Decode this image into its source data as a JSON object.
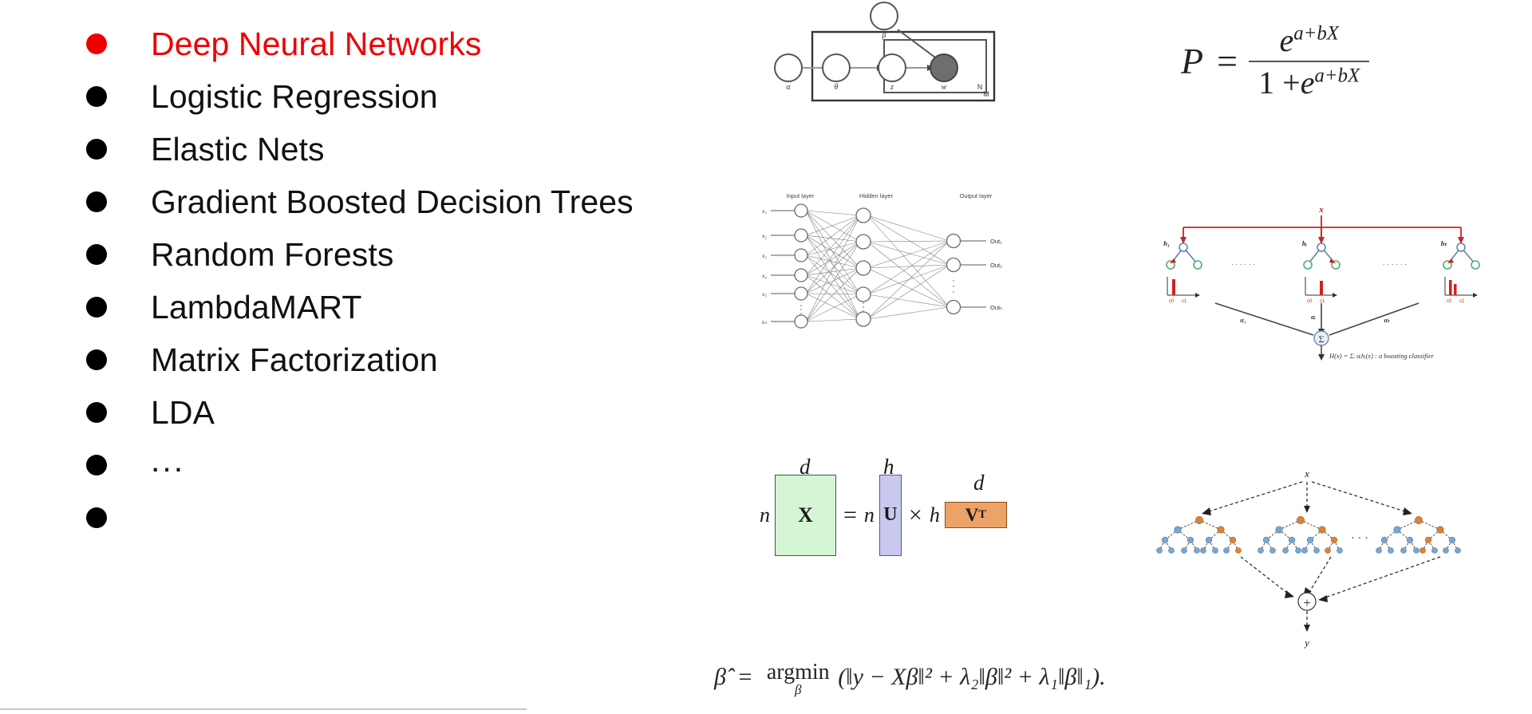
{
  "slide": {
    "background_color": "#ffffff",
    "highlight_color": "#ee0000",
    "text_color": "#111111"
  },
  "bullet_list": {
    "items": [
      {
        "label": "Deep Neural Networks",
        "highlighted": true
      },
      {
        "label": "Logistic Regression",
        "highlighted": false
      },
      {
        "label": "Elastic Nets",
        "highlighted": false
      },
      {
        "label": "Gradient Boosted Decision Trees",
        "highlighted": false
      },
      {
        "label": "Random Forests",
        "highlighted": false
      },
      {
        "label": "LambdaMART",
        "highlighted": false
      },
      {
        "label": "Matrix Factorization",
        "highlighted": false
      },
      {
        "label": "LDA",
        "highlighted": false
      },
      {
        "label": "...",
        "highlighted": false
      },
      {
        "label": "",
        "highlighted": false
      }
    ]
  },
  "figures": {
    "lda_plate": {
      "name": "LDA plate diagram",
      "nodes": [
        {
          "id": "alpha",
          "label": "α",
          "shaded": false
        },
        {
          "id": "theta",
          "label": "θ",
          "shaded": false
        },
        {
          "id": "z",
          "label": "z",
          "shaded": false
        },
        {
          "id": "w",
          "label": "w",
          "shaded": true
        },
        {
          "id": "beta",
          "label": "β",
          "shaded": false
        }
      ],
      "plates": [
        {
          "id": "outer",
          "label": "M"
        },
        {
          "id": "inner",
          "label": "N"
        }
      ]
    },
    "logistic_formula": {
      "lhs": "P",
      "equals": "=",
      "numerator_base": "e",
      "numerator_exponent": "a+bX",
      "denominator_one": "1 +",
      "denominator_base": "e",
      "denominator_exponent": "a+bX"
    },
    "neural_network": {
      "layer_labels": [
        "Input layer",
        "Hidden layer",
        "Output layer"
      ],
      "input_labels": [
        "x₁",
        "x₂",
        "x₃",
        "x₄",
        "x₅",
        "xₙ"
      ],
      "output_labels": [
        "Out₁",
        "Out₂",
        "Outₙ"
      ],
      "input_count": 6,
      "hidden_count": 5,
      "output_count": 3
    },
    "boosting": {
      "input_label": "x",
      "classifier_labels": [
        "h₁",
        "hᵢ",
        "hₜ"
      ],
      "weight_labels": [
        "α₁",
        "αᵢ",
        "αₜ"
      ],
      "leaf_axis_labels": [
        "c0",
        "c1"
      ],
      "sum_symbol": "Σ",
      "caption": "H(x) = Σᵢ αᵢhᵢ(x) : a boosting classifier",
      "ellipsis": "· · · · · ·",
      "arrow_color": "#cc2222",
      "node_color": "#7b97c4",
      "leaf_color": "#4fae72"
    },
    "matrix_factorization": {
      "left_dim_top": "d",
      "left_dim_side": "n",
      "left_matrix": "X",
      "left_color": "#d5f5d5",
      "equals": "=",
      "u_dim_top": "h",
      "u_dim_side": "n",
      "u_matrix": "U",
      "u_color": "#c9c9f0",
      "times": "×",
      "v_dim_top": "d",
      "v_dim_side": "h",
      "v_matrix": "V",
      "v_superscript": "T",
      "v_color": "#eda267"
    },
    "random_forest": {
      "input_label": "x",
      "output_label": "y",
      "combine_symbol": "+",
      "ellipsis": "· · ·",
      "tree_count": 3,
      "split_node_color": "#d9833d",
      "leaf_node_color": "#7ba6d0"
    },
    "elastic_net_formula": {
      "lhs": "β̂",
      "equals": "=",
      "operator": "argmin",
      "operator_subscript": "β",
      "expression": "(‖y − Xβ‖² + λ₂‖β‖² + λ₁‖β‖₁).",
      "term_1": "‖y − Xβ‖²",
      "term_2": "λ₂‖β‖²",
      "term_3": "λ₁‖β‖₁"
    }
  }
}
